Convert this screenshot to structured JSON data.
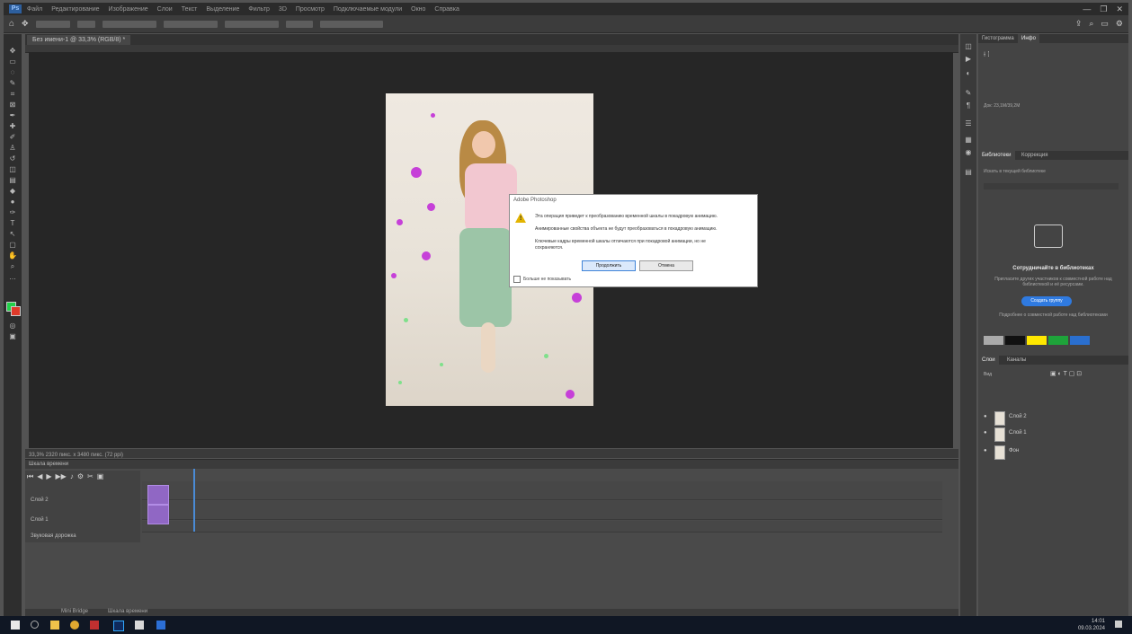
{
  "app": {
    "logo": "Ps"
  },
  "menubar": {
    "items": [
      "Файл",
      "Редактирование",
      "Изображение",
      "Слои",
      "Текст",
      "Выделение",
      "Фильтр",
      "3D",
      "Просмотр",
      "Подключаемые модули",
      "Окно",
      "Справка"
    ],
    "window_controls": [
      "—",
      "❐",
      "✕"
    ]
  },
  "document": {
    "tab_label": "Без имени-1 @ 33,3% (RGB/8) *"
  },
  "dialog": {
    "title": "Adobe Photoshop",
    "lines": [
      "Эта операция приведет к преобразованию временной шкалы в покадровую анимацию.",
      "Анимированные свойства объекта не будут преобразоваться в покадровую анимацию.",
      "Ключевые кадры временной шкалы отличаются при покадровой анимации, но не",
      "сохраняются."
    ],
    "continue_label": "Продолжить",
    "cancel_label": "Отмена",
    "dont_show_label": "Больше не показывать"
  },
  "statusbar": {
    "text": "33,3%     2320 пикс. x 3480 пикс. (72 ppi)"
  },
  "timeline": {
    "title": "Шкала времени",
    "tracks": [
      "Слой 2",
      "Слой 1"
    ],
    "audio_label": "Звуковая дорожка"
  },
  "bottom_tabs": [
    "Mini Bridge",
    "Шкала времени"
  ],
  "right_panels": {
    "top_tabs": [
      "Гистограмма",
      "Инфо"
    ],
    "info_text": "Док: 23,1M/39,2M",
    "libraries_tabs": [
      "Библиотеки",
      "Коррекция"
    ],
    "libraries_search": "Искать в текущей библиотеке",
    "libraries_title": "Сотрудничайте в библиотеках",
    "libraries_desc": "Пригласите других участников к совместной работе над библиотекой и её ресурсами.",
    "libraries_button": "Создать группу",
    "libraries_footer": "Подробнее о совместной работе над библиотеками",
    "layers_tabs": [
      "Слои",
      "Каналы"
    ],
    "layer_kind": "Вид",
    "layers": [
      "Слой 2",
      "Слой 1",
      "Фон"
    ]
  },
  "swatches": [
    "#aaaaaa",
    "#111111",
    "#ffe800",
    "#1ea33a",
    "#2a6fcf"
  ],
  "taskbar": {
    "time": "14:01",
    "date": "09.03.2024"
  }
}
